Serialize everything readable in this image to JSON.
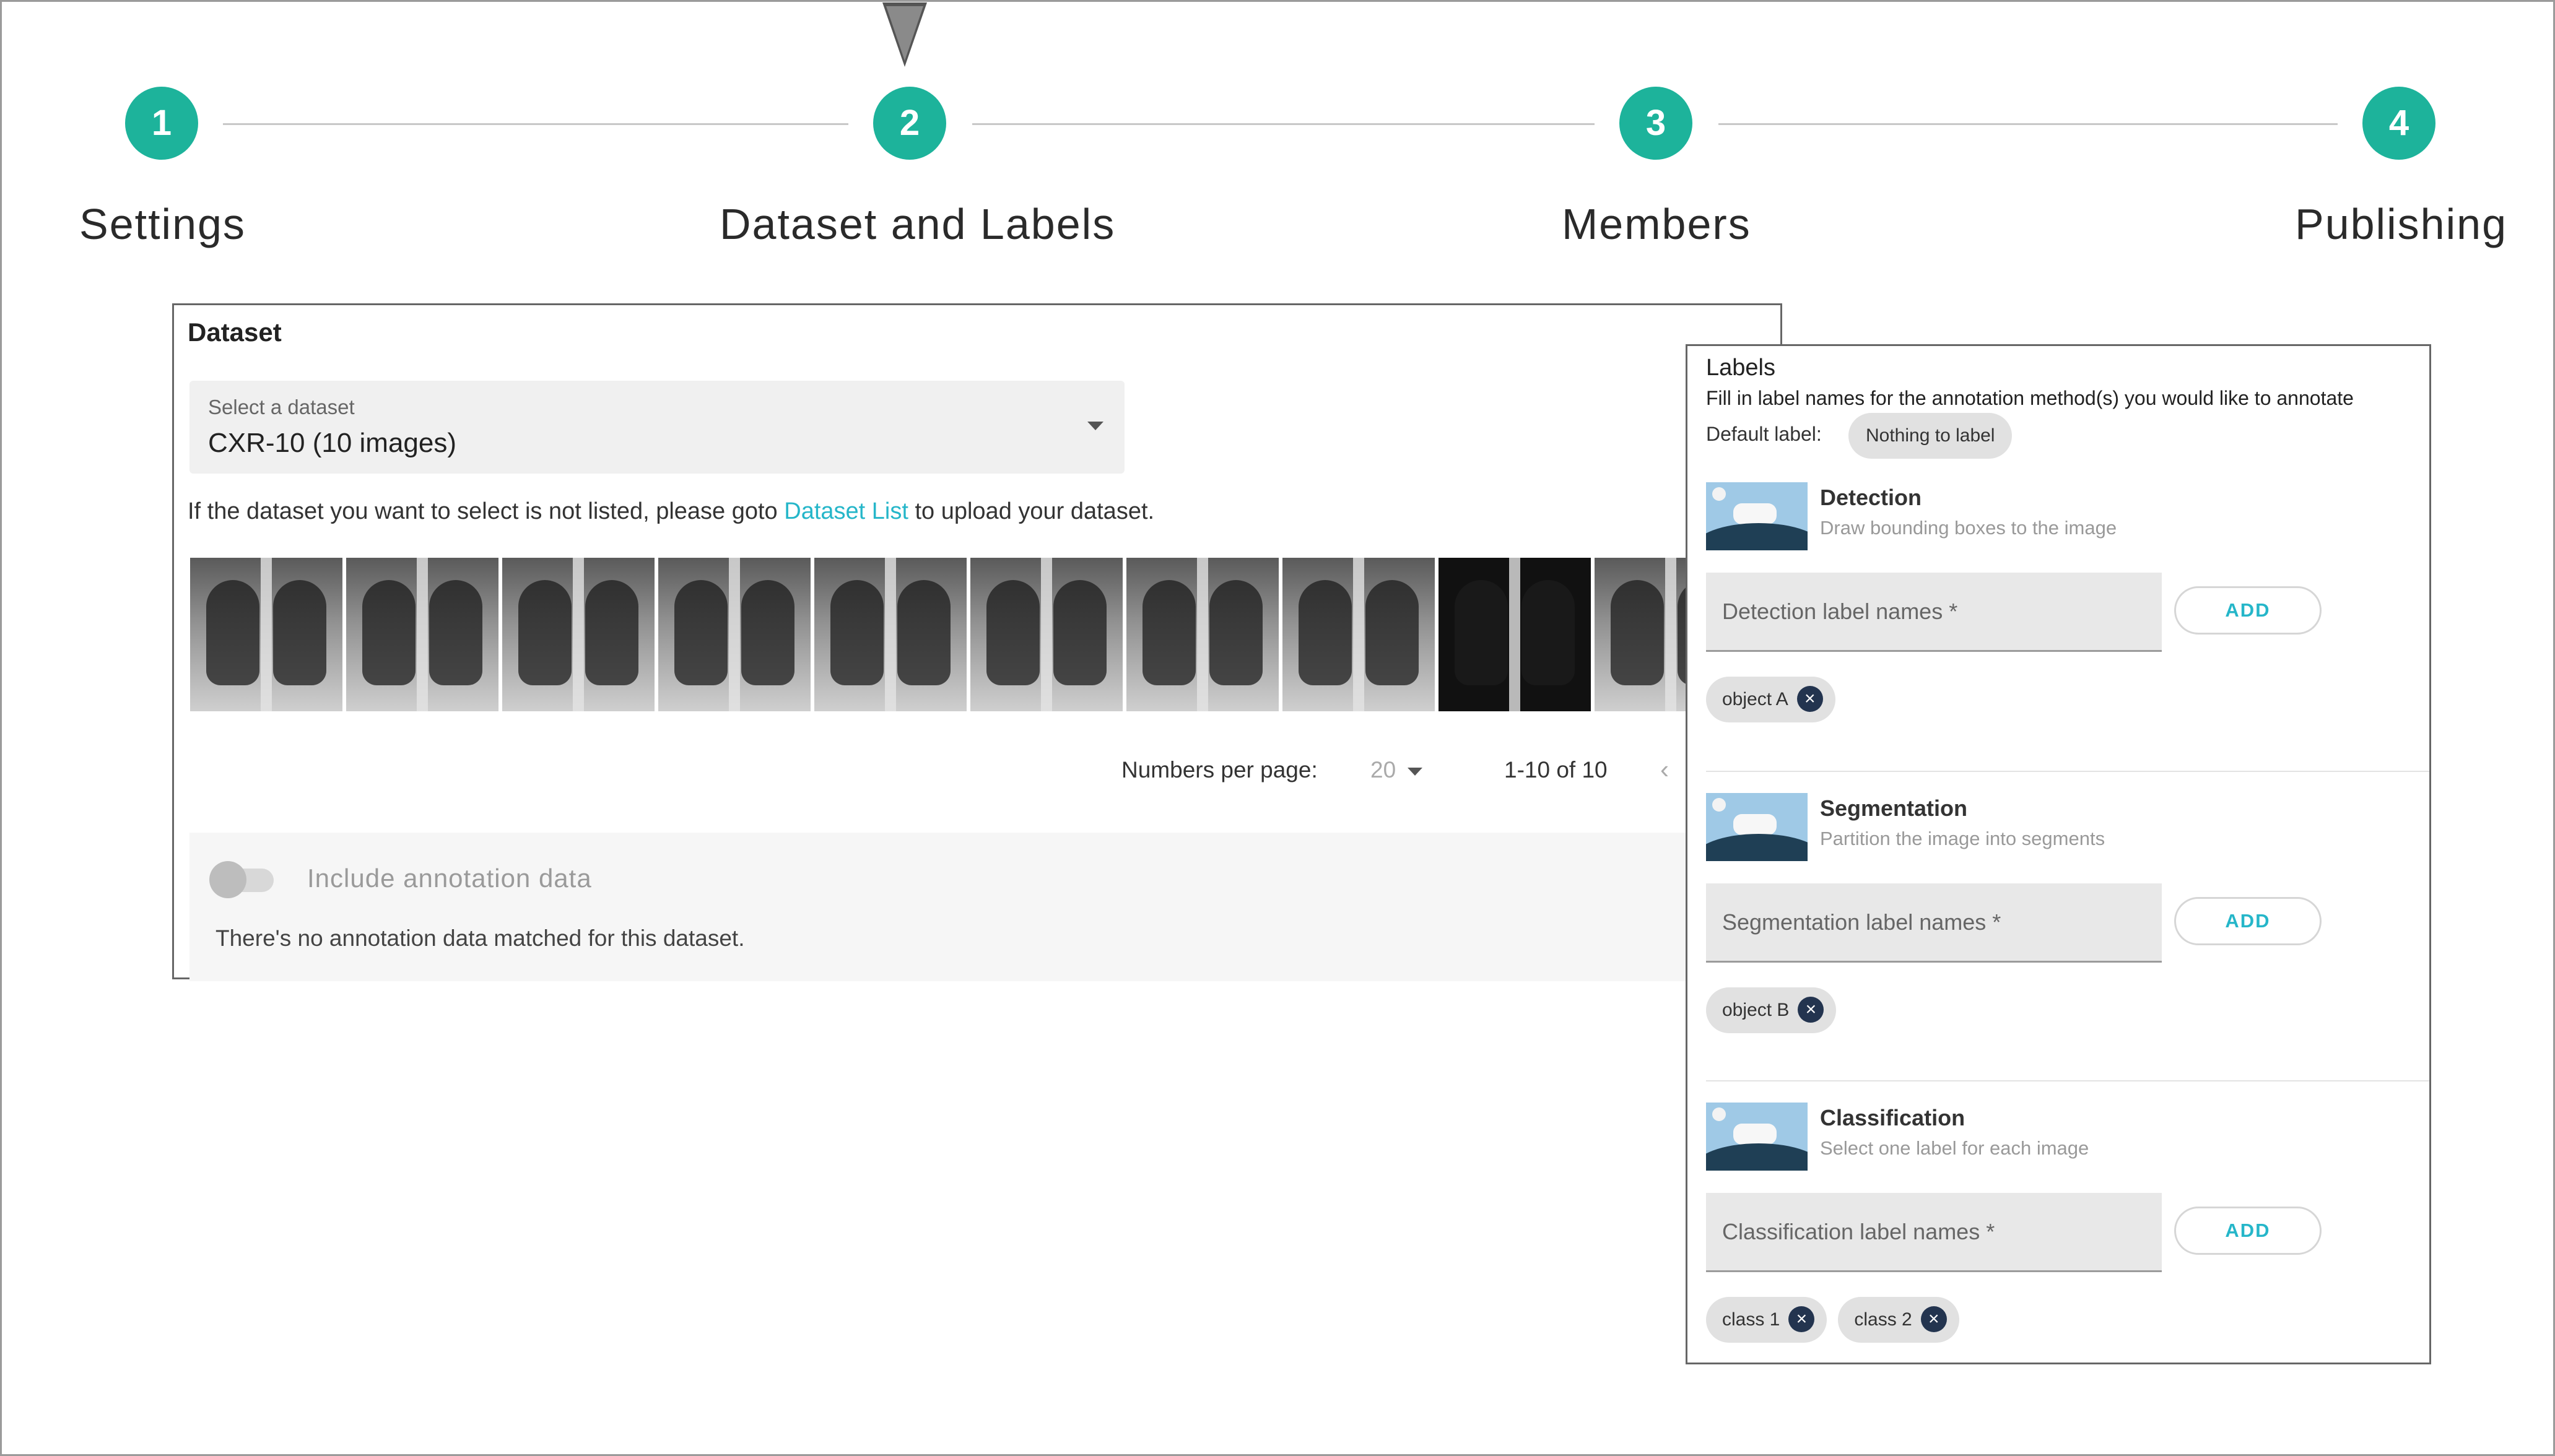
{
  "stepper": {
    "steps": [
      {
        "number": "1",
        "label": "Settings"
      },
      {
        "number": "2",
        "label": "Dataset and Labels"
      },
      {
        "number": "3",
        "label": "Members"
      },
      {
        "number": "4",
        "label": "Publishing"
      }
    ],
    "active_step": 2,
    "accent_color": "#1db39b"
  },
  "dataset": {
    "title": "Dataset",
    "select_label": "Select a dataset",
    "select_value": "CXR-10 (10 images)",
    "hint_before": "If the dataset you want to select is not listed, please goto ",
    "hint_link": "Dataset List",
    "hint_after": " to upload your dataset.",
    "pager": {
      "per_page_label": "Numbers per page:",
      "per_page_value": "20",
      "range": "1-10 of 10"
    },
    "annotation": {
      "toggle_label": "Include annotation data",
      "toggle_on": false,
      "note": "There's no annotation data matched for this dataset."
    }
  },
  "labels": {
    "title": "Labels",
    "description": "Fill in label names for the annotation method(s) you would like to annotate",
    "default_label_caption": "Default label:",
    "default_label_value": "Nothing to label",
    "sections": [
      {
        "name": "Detection",
        "subtitle": "Draw bounding boxes to the image",
        "placeholder": "Detection label names *",
        "add_label": "ADD",
        "chips": [
          "object A"
        ]
      },
      {
        "name": "Segmentation",
        "subtitle": "Partition the image into segments",
        "placeholder": "Segmentation label names *",
        "add_label": "ADD",
        "chips": [
          "object B"
        ]
      },
      {
        "name": "Classification",
        "subtitle": "Select one label for each image",
        "placeholder": "Classification label names *",
        "add_label": "ADD",
        "chips": [
          "class 1",
          "class 2"
        ]
      }
    ],
    "remove_icon": "close-circle-icon",
    "link_color": "#25b6c9"
  }
}
